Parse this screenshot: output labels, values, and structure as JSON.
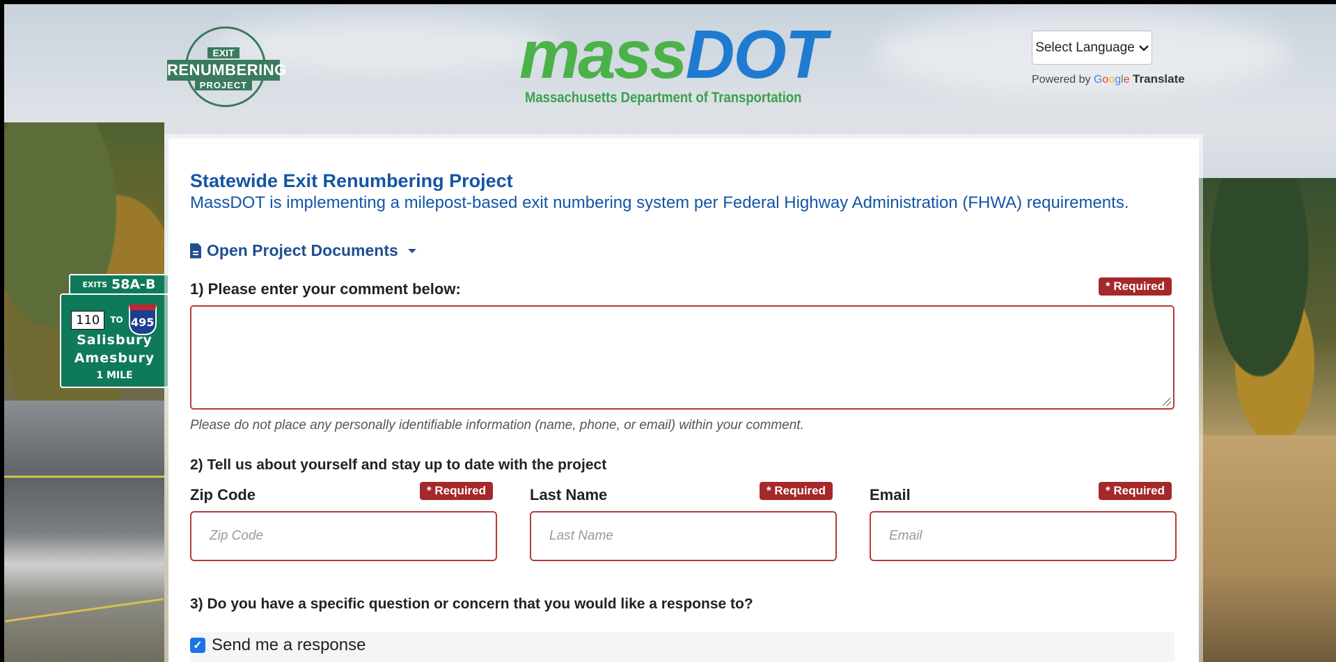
{
  "header": {
    "exit_logo": {
      "line1": "EXIT",
      "line2": "RENUMBERING",
      "line3": "PROJECT"
    },
    "massdot_logo": {
      "mass": "mass",
      "dot": "DOT",
      "subtitle": "Massachusetts Department of Transportation"
    },
    "language_select": {
      "label": "Select Language",
      "icon": "chevron-down-icon"
    },
    "powered_by": {
      "prefix": "Powered by",
      "google": [
        "G",
        "o",
        "o",
        "g",
        "l",
        "e"
      ],
      "translate": "Translate"
    }
  },
  "background_sign": {
    "exits": "EXITS",
    "exit_numbers": "58A-B",
    "route1": "110",
    "to": "TO",
    "route2": "495",
    "city1": "Salisbury",
    "city2": "Amesbury",
    "distance": "1 MILE"
  },
  "card": {
    "title": "Statewide Exit Renumbering Project",
    "subtitle": "MassDOT is implementing a milepost-based exit numbering system per Federal Highway Administration (FHWA) requirements.",
    "documents_menu": {
      "label": "Open Project Documents",
      "icon": "document-icon"
    },
    "question1": {
      "label": "1) Please enter your comment below:",
      "required": "* Required",
      "value": "",
      "hint": "Please do not place any personally identifiable information (name, phone, or email) within your comment."
    },
    "question2": {
      "label": "2) Tell us about yourself and stay up to date with the project",
      "fields": [
        {
          "label": "Zip Code",
          "required": "* Required",
          "placeholder": "Zip Code",
          "value": ""
        },
        {
          "label": "Last Name",
          "required": "* Required",
          "placeholder": "Last Name",
          "value": ""
        },
        {
          "label": "Email",
          "required": "* Required",
          "placeholder": "Email",
          "value": ""
        }
      ]
    },
    "question3": {
      "label": "3) Do you have a specific question or concern that you would like a response to?",
      "checkbox_label": "Send me a response",
      "checked": true
    }
  },
  "colors": {
    "title_blue": "#1255a6",
    "required_red": "#a5282a",
    "input_border": "#b33b3b",
    "mass_green": "#4bb24a",
    "dot_blue": "#1f7bd0",
    "checkbox_blue": "#1a73e8"
  }
}
